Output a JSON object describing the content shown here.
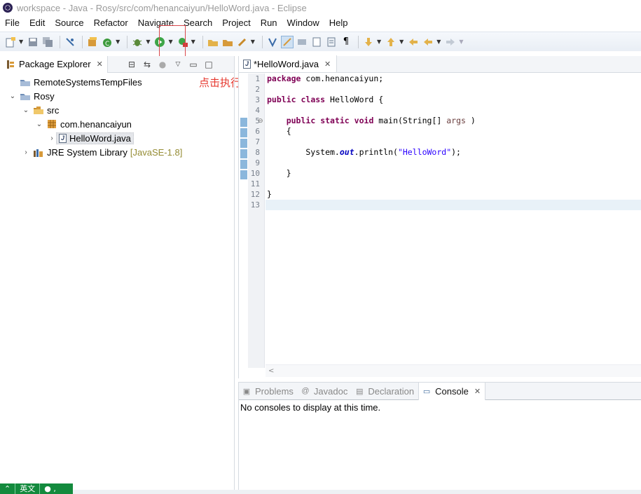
{
  "window": {
    "title": "workspace - Java - Rosy/src/com/henancaiyun/HelloWord.java - Eclipse"
  },
  "menu": [
    "File",
    "Edit",
    "Source",
    "Refactor",
    "Navigate",
    "Search",
    "Project",
    "Run",
    "Window",
    "Help"
  ],
  "left_panel": {
    "tab_label": "Package Explorer",
    "tree": {
      "remote": "RemoteSystemsTempFiles",
      "project": "Rosy",
      "src": "src",
      "package": "com.henancaiyun",
      "file": "HelloWord.java",
      "jre": "JRE System Library",
      "jre_tag": "[JavaSE-1.8]"
    }
  },
  "annotation": "点击执行",
  "editor": {
    "tab_label": "*HelloWord.java",
    "line_numbers": [
      "1",
      "2",
      "3",
      "4",
      "5",
      "6",
      "7",
      "8",
      "9",
      "10",
      "11",
      "12",
      "13"
    ],
    "code": {
      "l1_kw": "package",
      "l1_rest": " com.henancaiyun;",
      "l3_kw1": "public",
      "l3_kw2": "class",
      "l3_rest": " HelloWord {",
      "l5_kw1": "public",
      "l5_kw2": "static",
      "l5_kw3": "void",
      "l5_rest": " main(String[] ",
      "l5_param": "args",
      "l5_end": " )",
      "l6": "    {",
      "l8_pre": "        System.",
      "l8_field": "out",
      "l8_mid": ".println(",
      "l8_str": "\"HelloWord\"",
      "l8_end": ");",
      "l10": "    }",
      "l12": "}"
    },
    "hscroll_arrow": "<"
  },
  "console": {
    "tabs": [
      "Problems",
      "Javadoc",
      "Declaration",
      "Console"
    ],
    "active_tab": "Console",
    "message": "No consoles to display at this time."
  },
  "ime": {
    "mode": "英文",
    "punct": "● ,"
  }
}
